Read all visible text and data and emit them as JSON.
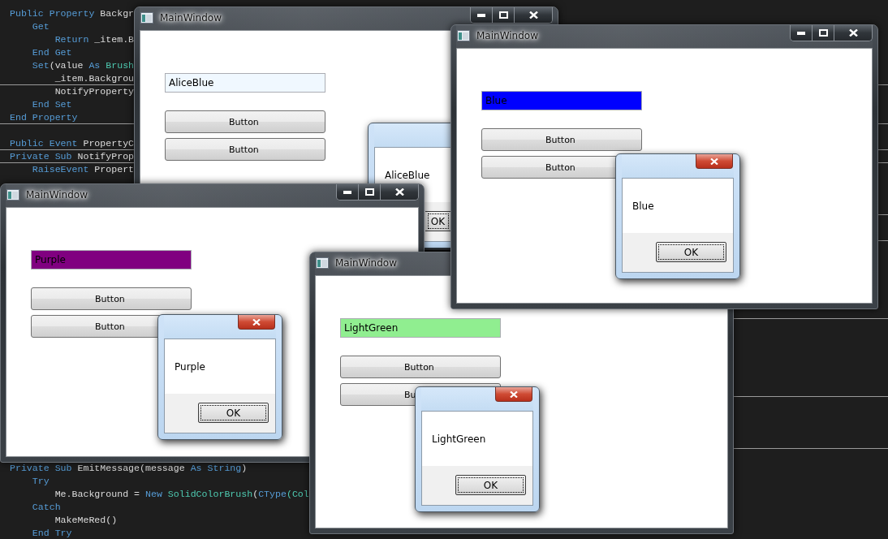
{
  "code_top": [
    {
      "tokens": [
        {
          "text": "Public Property",
          "kind": "keyword"
        },
        {
          "text": " Backgr",
          "kind": "text"
        }
      ]
    },
    {
      "tokens": [
        {
          "text": "    Get",
          "kind": "keyword"
        }
      ]
    },
    {
      "tokens": [
        {
          "text": "        Return",
          "kind": "keyword"
        },
        {
          "text": " _item.B",
          "kind": "text"
        }
      ]
    },
    {
      "tokens": [
        {
          "text": "    End Get",
          "kind": "keyword"
        }
      ]
    },
    {
      "tokens": [
        {
          "text": "    Set",
          "kind": "keyword"
        },
        {
          "text": "(value ",
          "kind": "text"
        },
        {
          "text": "As",
          "kind": "keyword"
        },
        {
          "text": " Brush",
          "kind": "type"
        }
      ]
    },
    {
      "tokens": [
        {
          "text": "        _item.Backgrou",
          "kind": "text"
        }
      ]
    },
    {
      "tokens": [
        {
          "text": "        NotifyProperty",
          "kind": "text"
        }
      ]
    },
    {
      "tokens": [
        {
          "text": "    End Set",
          "kind": "keyword"
        }
      ]
    },
    {
      "tokens": [
        {
          "text": "End Property",
          "kind": "keyword"
        }
      ]
    }
  ],
  "code_middle": [
    {
      "tokens": [
        {
          "text": "Public Event",
          "kind": "keyword"
        },
        {
          "text": " PropertyC",
          "kind": "text"
        }
      ]
    },
    {
      "tokens": [
        {
          "text": "Private Sub",
          "kind": "keyword"
        },
        {
          "text": " NotifyProp",
          "kind": "text"
        }
      ]
    },
    {
      "tokens": [
        {
          "text": "    RaiseEvent",
          "kind": "keyword"
        },
        {
          "text": " Propert",
          "kind": "text"
        }
      ]
    }
  ],
  "code_bottom": [
    {
      "tokens": [
        {
          "text": "Private Sub",
          "kind": "keyword"
        },
        {
          "text": " EmitMessage(message ",
          "kind": "text"
        },
        {
          "text": "As String",
          "kind": "keyword"
        },
        {
          "text": ")",
          "kind": "text"
        }
      ]
    },
    {
      "tokens": [
        {
          "text": "    Try",
          "kind": "keyword"
        }
      ]
    },
    {
      "tokens": [
        {
          "text": "        Me.Background = ",
          "kind": "text"
        },
        {
          "text": "New",
          "kind": "keyword"
        },
        {
          "text": " SolidColorBrush",
          "kind": "type"
        },
        {
          "text": "(",
          "kind": "text"
        },
        {
          "text": "CType",
          "kind": "keyword"
        },
        {
          "text": "(Col",
          "kind": "type"
        }
      ]
    },
    {
      "tokens": [
        {
          "text": "    Catch",
          "kind": "keyword"
        }
      ]
    },
    {
      "tokens": [
        {
          "text": "        MakeMeRed()",
          "kind": "text"
        }
      ]
    },
    {
      "tokens": [
        {
          "text": "    End Try",
          "kind": "keyword"
        }
      ]
    }
  ],
  "windows": [
    {
      "title": "MainWindow",
      "caption_buttons": true,
      "field": {
        "value": "AliceBlue",
        "color": "#f0f8ff"
      },
      "buttons": [
        "Button",
        "Button"
      ],
      "dialog": {
        "message": "AliceBlue",
        "close_button": false,
        "ok": "OK"
      }
    },
    {
      "title": "MainWindow",
      "caption_buttons": true,
      "field": {
        "value": "Purple",
        "color": "#800080"
      },
      "buttons": [
        "Button",
        "Button"
      ],
      "dialog": {
        "message": "Purple",
        "close_button": true,
        "ok": "OK"
      }
    },
    {
      "title": "MainWindow",
      "caption_buttons": false,
      "field": {
        "value": "LightGreen",
        "color": "#90ee90"
      },
      "buttons": [
        "Button",
        "Bu"
      ],
      "dialog": {
        "message": "LightGreen",
        "close_button": true,
        "ok": "OK"
      }
    },
    {
      "title": "MainWindow",
      "caption_buttons": true,
      "field": {
        "value": "Blue",
        "color": "#0000ff"
      },
      "buttons": [
        "Button",
        "Button"
      ],
      "dialog": {
        "message": "Blue",
        "close_button": true,
        "ok": "OK"
      }
    }
  ]
}
